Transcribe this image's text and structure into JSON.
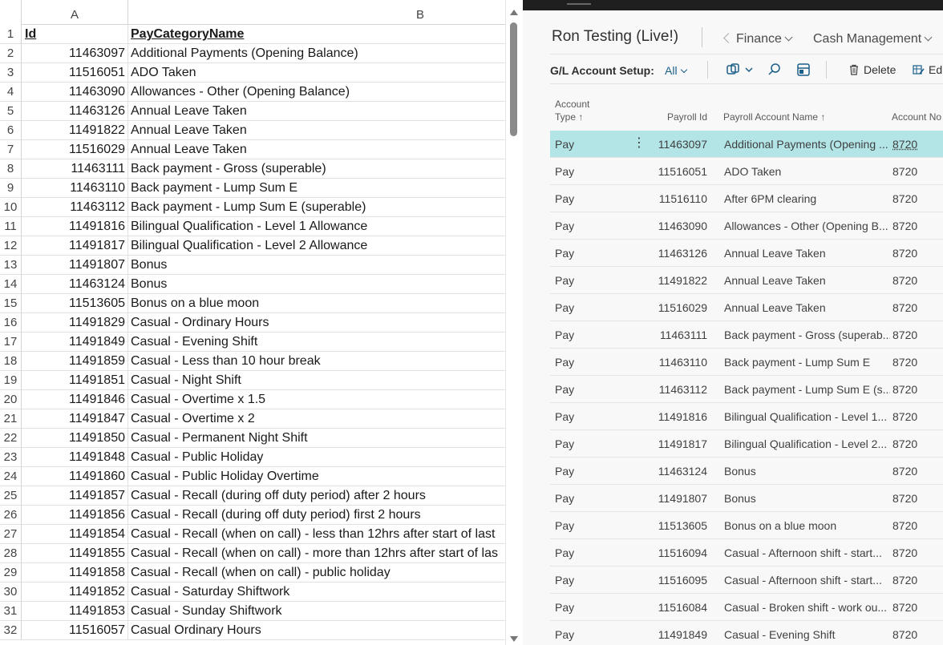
{
  "excel": {
    "columns": [
      "A",
      "B"
    ],
    "header": {
      "row": "1",
      "a": "Id",
      "b": "PayCategoryName"
    },
    "rows": [
      {
        "n": "2",
        "a": "11463097",
        "b": "Additional Payments (Opening Balance)"
      },
      {
        "n": "3",
        "a": "11516051",
        "b": "ADO Taken"
      },
      {
        "n": "4",
        "a": "11463090",
        "b": "Allowances - Other (Opening Balance)"
      },
      {
        "n": "5",
        "a": "11463126",
        "b": "Annual Leave Taken"
      },
      {
        "n": "6",
        "a": "11491822",
        "b": "Annual Leave Taken"
      },
      {
        "n": "7",
        "a": "11516029",
        "b": "Annual Leave Taken"
      },
      {
        "n": "8",
        "a": "11463111",
        "b": "Back payment - Gross (superable)"
      },
      {
        "n": "9",
        "a": "11463110",
        "b": "Back payment - Lump Sum E"
      },
      {
        "n": "10",
        "a": "11463112",
        "b": "Back payment - Lump Sum E (superable)"
      },
      {
        "n": "11",
        "a": "11491816",
        "b": "Bilingual Qualification - Level 1 Allowance"
      },
      {
        "n": "12",
        "a": "11491817",
        "b": "Bilingual Qualification - Level 2 Allowance"
      },
      {
        "n": "13",
        "a": "11491807",
        "b": "Bonus"
      },
      {
        "n": "14",
        "a": "11463124",
        "b": "Bonus"
      },
      {
        "n": "15",
        "a": "11513605",
        "b": "Bonus on a blue moon"
      },
      {
        "n": "16",
        "a": "11491829",
        "b": "Casual - Ordinary Hours"
      },
      {
        "n": "17",
        "a": "11491849",
        "b": "Casual - Evening Shift"
      },
      {
        "n": "18",
        "a": "11491859",
        "b": "Casual - Less than 10 hour break"
      },
      {
        "n": "19",
        "a": "11491851",
        "b": "Casual - Night Shift"
      },
      {
        "n": "20",
        "a": "11491846",
        "b": "Casual - Overtime x 1.5"
      },
      {
        "n": "21",
        "a": "11491847",
        "b": "Casual - Overtime x 2"
      },
      {
        "n": "22",
        "a": "11491850",
        "b": "Casual - Permanent Night Shift"
      },
      {
        "n": "23",
        "a": "11491848",
        "b": "Casual - Public Holiday"
      },
      {
        "n": "24",
        "a": "11491860",
        "b": "Casual - Public Holiday Overtime"
      },
      {
        "n": "25",
        "a": "11491857",
        "b": "Casual - Recall (during off duty period) after 2 hours"
      },
      {
        "n": "26",
        "a": "11491856",
        "b": "Casual - Recall (during off duty period) first 2 hours"
      },
      {
        "n": "27",
        "a": "11491854",
        "b": "Casual - Recall (when on call) - less than 12hrs after start of last"
      },
      {
        "n": "28",
        "a": "11491855",
        "b": "Casual - Recall (when on call) - more than 12hrs after start of las"
      },
      {
        "n": "29",
        "a": "11491858",
        "b": "Casual - Recall (when on call) - public holiday"
      },
      {
        "n": "30",
        "a": "11491852",
        "b": "Casual - Saturday Shiftwork"
      },
      {
        "n": "31",
        "a": "11491853",
        "b": "Casual - Sunday Shiftwork"
      },
      {
        "n": "32",
        "a": "11516057",
        "b": "Casual Ordinary Hours"
      }
    ]
  },
  "bc": {
    "company": "Ron Testing (Live!)",
    "nav": {
      "finance": "Finance",
      "cash_management": "Cash Management"
    },
    "action_bar": {
      "label": "G/L Account Setup:",
      "filter": "All",
      "delete": "Delete",
      "edit": "Edi"
    },
    "columns": {
      "account_type_1": "Account",
      "account_type_2": "Type ↑",
      "payroll_id": "Payroll Id",
      "payroll_account_name": "Payroll Account Name ↑",
      "account_no": "Account No"
    },
    "rows": [
      {
        "type": "Pay",
        "id": "11463097",
        "name": "Additional Payments (Opening ...",
        "acct": "8720",
        "selected": true
      },
      {
        "type": "Pay",
        "id": "11516051",
        "name": "ADO Taken",
        "acct": "8720"
      },
      {
        "type": "Pay",
        "id": "11516110",
        "name": "After 6PM clearing",
        "acct": "8720"
      },
      {
        "type": "Pay",
        "id": "11463090",
        "name": "Allowances - Other (Opening B...",
        "acct": "8720"
      },
      {
        "type": "Pay",
        "id": "11463126",
        "name": "Annual Leave Taken",
        "acct": "8720"
      },
      {
        "type": "Pay",
        "id": "11491822",
        "name": "Annual Leave Taken",
        "acct": "8720"
      },
      {
        "type": "Pay",
        "id": "11516029",
        "name": "Annual Leave Taken",
        "acct": "8720"
      },
      {
        "type": "Pay",
        "id": "11463111",
        "name": "Back payment - Gross (superab...",
        "acct": "8720"
      },
      {
        "type": "Pay",
        "id": "11463110",
        "name": "Back payment - Lump Sum E",
        "acct": "8720"
      },
      {
        "type": "Pay",
        "id": "11463112",
        "name": "Back payment - Lump Sum E (s...",
        "acct": "8720"
      },
      {
        "type": "Pay",
        "id": "11491816",
        "name": "Bilingual Qualification - Level 1...",
        "acct": "8720"
      },
      {
        "type": "Pay",
        "id": "11491817",
        "name": "Bilingual Qualification - Level 2...",
        "acct": "8720"
      },
      {
        "type": "Pay",
        "id": "11463124",
        "name": "Bonus",
        "acct": "8720"
      },
      {
        "type": "Pay",
        "id": "11491807",
        "name": "Bonus",
        "acct": "8720"
      },
      {
        "type": "Pay",
        "id": "11513605",
        "name": "Bonus on a blue moon",
        "acct": "8720"
      },
      {
        "type": "Pay",
        "id": "11516094",
        "name": "Casual - Afternoon shift - start...",
        "acct": "8720"
      },
      {
        "type": "Pay",
        "id": "11516095",
        "name": "Casual - Afternoon shift - start...",
        "acct": "8720"
      },
      {
        "type": "Pay",
        "id": "11516084",
        "name": "Casual - Broken shift - work ou...",
        "acct": "8720"
      },
      {
        "type": "Pay",
        "id": "11491849",
        "name": "Casual - Evening Shift",
        "acct": "8720"
      }
    ],
    "colors": {
      "selected_row": "#b3e5e7",
      "link": "#1a5e8a"
    }
  }
}
